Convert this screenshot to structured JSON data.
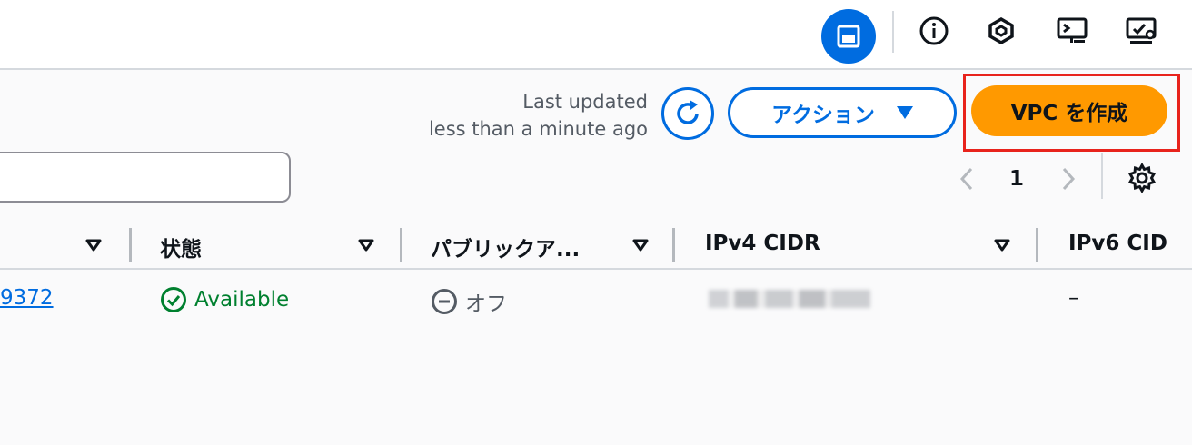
{
  "topbar": {
    "icons": [
      "panel-icon",
      "info-icon",
      "hex-icon",
      "terminal-icon",
      "screen-settings-icon"
    ]
  },
  "header": {
    "last_updated_label": "Last updated",
    "last_updated_value": "less than a minute ago",
    "action_label": "アクション",
    "create_label": "VPC を作成"
  },
  "search": {
    "value": "",
    "placeholder": ""
  },
  "pagination": {
    "current_page": "1"
  },
  "table": {
    "columns": [
      {
        "label": ""
      },
      {
        "label": "状態"
      },
      {
        "label": "パブリックア..."
      },
      {
        "label": "IPv4 CIDR"
      },
      {
        "label": "IPv6 CID"
      }
    ],
    "rows": [
      {
        "vpc_id": "9372",
        "status": "Available",
        "public_access": "オフ",
        "ipv4_cidr": "",
        "ipv6_cidr": "–"
      }
    ]
  },
  "colors": {
    "accent": "#006ce0",
    "primary_button": "#ff9900",
    "success": "#00802f",
    "highlight_box": "#e8231c"
  }
}
